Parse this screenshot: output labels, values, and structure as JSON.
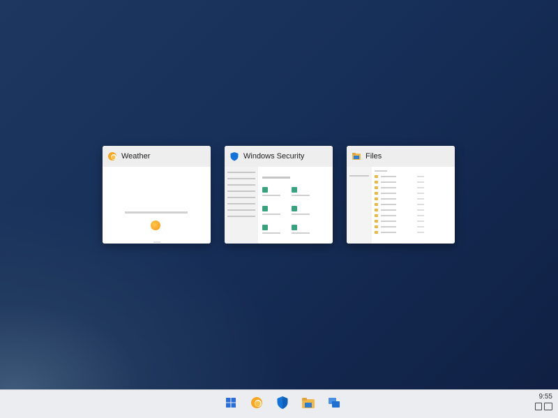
{
  "task_view": {
    "windows": [
      {
        "title": "Weather",
        "icon": "weather-sun-icon"
      },
      {
        "title": "Windows Security",
        "icon": "shield-icon"
      },
      {
        "title": "Files",
        "icon": "folder-icon"
      }
    ]
  },
  "taskbar": {
    "apps": [
      {
        "name": "Start",
        "icon": "windows-start-icon"
      },
      {
        "name": "Weather",
        "icon": "weather-sun-icon"
      },
      {
        "name": "Windows Security",
        "icon": "shield-icon"
      },
      {
        "name": "Files",
        "icon": "folder-icon"
      },
      {
        "name": "Task View",
        "icon": "task-view-icon"
      }
    ],
    "clock": "9:55"
  },
  "colors": {
    "shield": "#1473d8",
    "sun": "#f6a623",
    "folder": "#f2b84b",
    "start": "#2b6fd6",
    "taskview": "#1f6fd1"
  }
}
